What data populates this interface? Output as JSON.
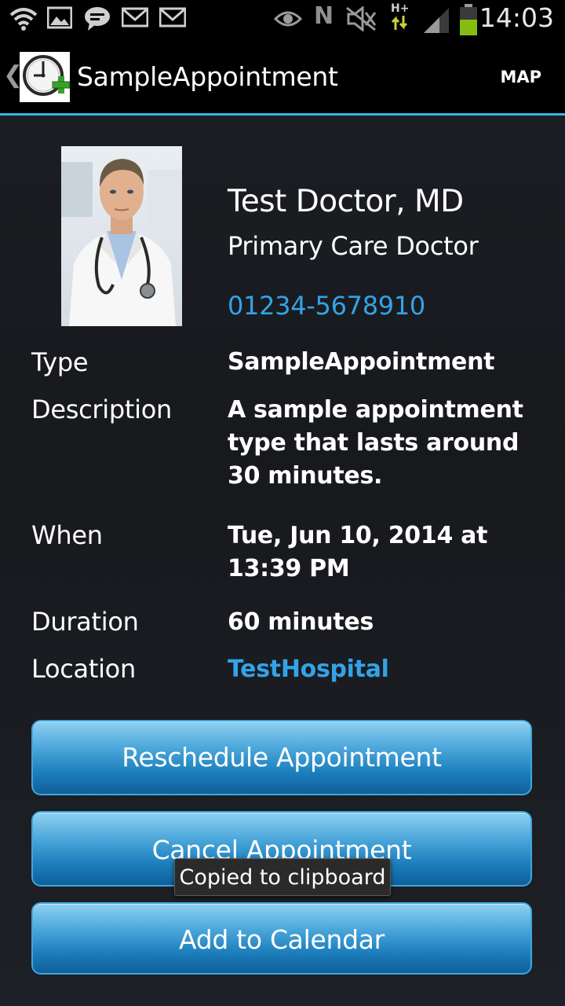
{
  "status_bar": {
    "time": "14:03",
    "icons": [
      "wifi-icon",
      "gallery-icon",
      "chat-icon",
      "gmail-icon",
      "gmail-icon",
      "eye-icon",
      "nfc-icon",
      "mute-icon",
      "network-hplus-icon",
      "signal-icon",
      "battery-icon"
    ],
    "network_label": "H+",
    "nfc_label": "N"
  },
  "action_bar": {
    "title": "SampleAppointment",
    "action_label": "MAP",
    "up_glyph": "❮"
  },
  "doctor": {
    "name": "Test Doctor, MD",
    "specialty": "Primary Care Doctor",
    "phone": "01234-5678910"
  },
  "details": {
    "type_label": "Type",
    "type_value": "SampleAppointment",
    "description_label": "Description",
    "description_value": "A sample appointment type that lasts around 30 minutes.",
    "when_label": "When",
    "when_value": "Tue, Jun 10, 2014 at 13:39 PM",
    "duration_label": "Duration",
    "duration_value": "60 minutes",
    "location_label": "Location",
    "location_value": "TestHospital"
  },
  "buttons": {
    "reschedule": "Reschedule Appointment",
    "cancel": "Cancel Appointment",
    "add_calendar": "Add to Calendar"
  },
  "toast": {
    "message": "Copied to clipboard"
  },
  "colors": {
    "accent_blue": "#33b5e5",
    "link_blue": "#33a3e8",
    "button_blue": "#1d7fbd",
    "background": "#17191d"
  }
}
